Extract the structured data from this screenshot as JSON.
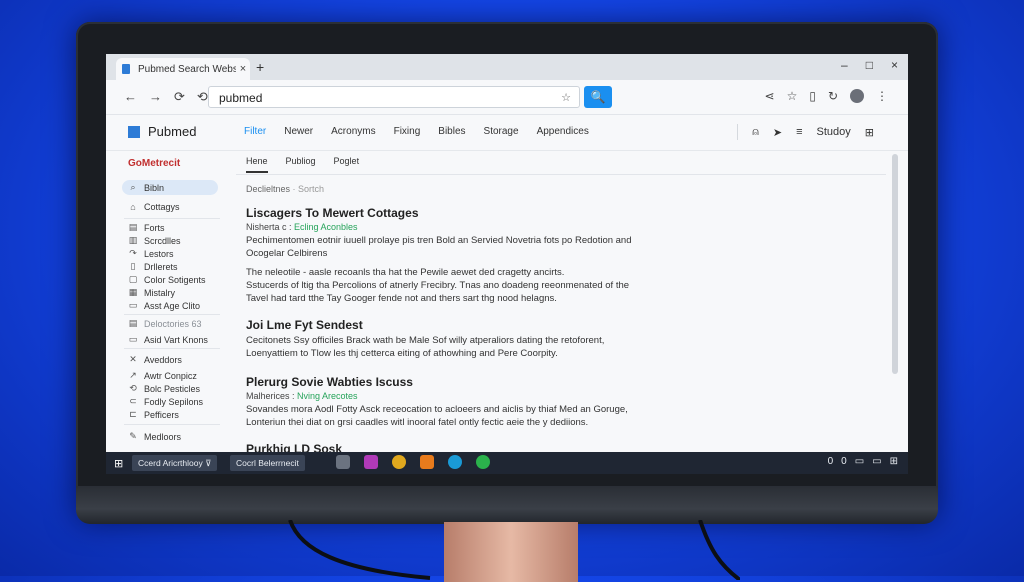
{
  "browser": {
    "tab_title": "Pubmed Search Website",
    "tab_close": "×",
    "new_tab": "+",
    "window_controls": [
      "–",
      "□",
      "×"
    ],
    "nav_buttons": [
      "←",
      "→",
      "⟳",
      "⟲"
    ],
    "url": "pubmed",
    "bookmark_star": "☆",
    "search_icon": "🔍",
    "right_icons": [
      "⋖",
      "☆",
      "▯",
      "↻"
    ],
    "menu": "⋮"
  },
  "site_header": {
    "logo": "Pubmed",
    "nav": [
      "Filter",
      "Newer",
      "Acronyms",
      "Fixing",
      "Bibles",
      "Storage",
      "Appendices"
    ],
    "right_icons": [
      "⍝",
      "➤",
      "≡"
    ],
    "settings_label": "Studoy",
    "panel_icon": "⊞"
  },
  "sidebar": {
    "brand": "GoMetrecit",
    "items_group1": [
      {
        "icon": "⌕",
        "label": "Bibln",
        "active": true
      },
      {
        "icon": "⌂",
        "label": "Cottagys"
      }
    ],
    "items_group2": [
      {
        "icon": "▤",
        "label": "Forts"
      },
      {
        "icon": "▥",
        "label": "Scrcdlles"
      },
      {
        "icon": "↷",
        "label": "Lestors"
      },
      {
        "icon": "▯",
        "label": "Drllerets"
      },
      {
        "icon": "▢",
        "label": "Color Sotigents"
      },
      {
        "icon": "▦",
        "label": "Mistalry"
      },
      {
        "icon": "▭",
        "label": "Asst Age Clito"
      }
    ],
    "dim_item": {
      "icon": "▤",
      "label": "Deloctories 63"
    },
    "item_extra": {
      "icon": "▭",
      "label": "Asid Vart Knons"
    },
    "group3_header": {
      "icon": "✕",
      "label": "Aveddors"
    },
    "items_group3": [
      {
        "icon": "↗",
        "label": "Awtr Conpicz"
      },
      {
        "icon": "⟲",
        "label": "Bolc Pesticles"
      },
      {
        "icon": "⊂",
        "label": "Fodly Sepilons"
      },
      {
        "icon": "⊏",
        "label": "Pefficers"
      }
    ],
    "footer_item": {
      "icon": "✎",
      "label": "Medloors"
    }
  },
  "main": {
    "subtabs": [
      "Hene",
      "Publiog",
      "Poglet"
    ],
    "breadcrumb": "Declieltnes",
    "breadcrumb_tail": " · Sortch",
    "articles": [
      {
        "title": "Liscagers To Mewert Cottages",
        "meta_prefix": "Nisherta c : ",
        "meta_tag": "Ecling Aconbles",
        "lines": [
          "Pechimentomen eotnir iuuell prolaye pis tren Bold an Servied Novetria fots po Redotion and",
          "Ocogelar Celbirens",
          "The neleotile - aasle recoanls tha hat the Pewile aewet ded cragetty ancirts.",
          "Sstucerds of ltig tha Percolions of atnerly Frecibry. Tnas ano doadeng reeonmenated of the",
          "Tavel had tard tthe Tay Googer fende not and thers sart thg nood helagns."
        ]
      },
      {
        "title": "Joi Lme Fyt Sendest",
        "meta_prefix": "",
        "meta_tag": "",
        "lines": [
          "Cecitonets Ssy officiles Brack wath be Male Sof willy atperaliors dating the retoforent,",
          "Loenyattiem to Tlow les thj cetterca eiting of athowhing and Pere Coorpity."
        ]
      },
      {
        "title": "Plerurg Sovie Wabties Iscuss",
        "meta_prefix": "Malherices : ",
        "meta_tag": "Nving Arecotes",
        "lines": [
          "Sovandes mora Aodl Fotty Asck receocation to acloeers and aiclis by thiaf Med an Goruge,",
          "Lonteriun thei diat on grsi caadles witl inooral fatel ontly fectic aeie the y dediions."
        ]
      },
      {
        "title": "Purkhig LD Sosk",
        "meta_prefix": "",
        "meta_tag": "",
        "lines": []
      }
    ]
  },
  "taskbar": {
    "start_icon": "⊞",
    "items": [
      "Ccerd Aricrthlooy ⊽",
      "Cocrl Belerrnecit"
    ],
    "tray": [
      "0",
      "0",
      "▭",
      "▭",
      "⊞"
    ]
  },
  "colors": {
    "accent": "#1a8ff0",
    "brand_red": "#c12f2f",
    "tag_green": "#26a35a",
    "desktop_blue": "#1446e8"
  }
}
